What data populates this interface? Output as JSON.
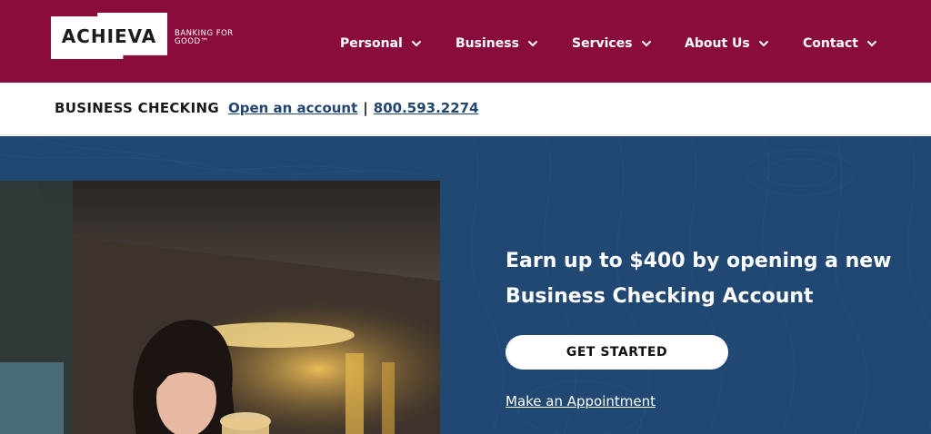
{
  "brand": {
    "name": "ACHIEVA",
    "tagline_line1": "BANKING FOR",
    "tagline_line2": "GOOD™"
  },
  "nav": {
    "items": [
      {
        "label": "Personal"
      },
      {
        "label": "Business"
      },
      {
        "label": "Services"
      },
      {
        "label": "About Us"
      },
      {
        "label": "Contact"
      }
    ]
  },
  "subbar": {
    "title": "BUSINESS CHECKING",
    "link_label": "Open an account",
    "separator": "|",
    "phone": "800.593.2274"
  },
  "hero": {
    "headline_line1": "Earn up to $400 by opening a new",
    "headline_line2": "Business Checking Account",
    "cta_label": "GET STARTED",
    "secondary_link": "Make an Appointment"
  },
  "colors": {
    "header_bg": "#8a0c3d",
    "hero_bg": "#214773",
    "link": "#21456f"
  },
  "icons": {
    "nav_chevron": "chevron-down-icon"
  }
}
